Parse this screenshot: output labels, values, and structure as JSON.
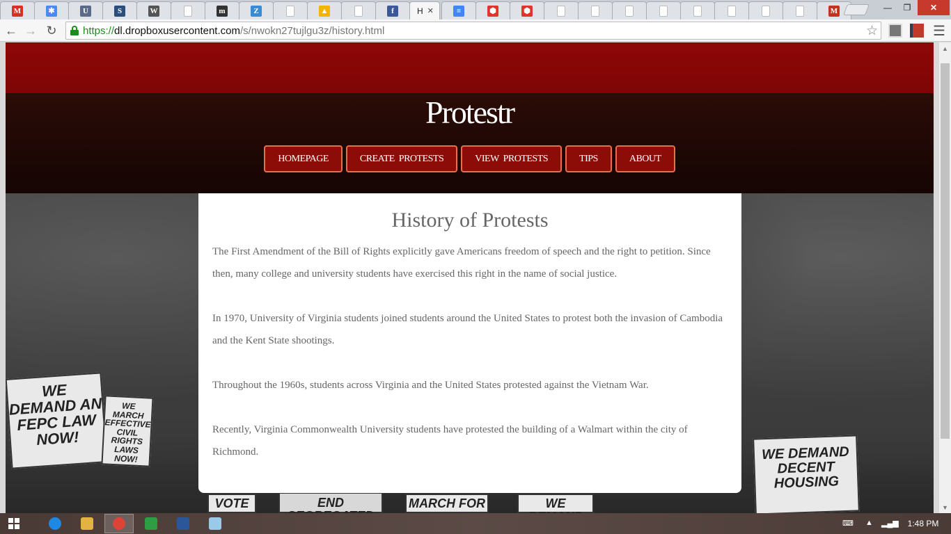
{
  "browser": {
    "active_tab": {
      "title": "H",
      "close": "✕"
    },
    "tabs": [
      {
        "icon": "gmail-icon",
        "glyph": "M",
        "color": "#d93025"
      },
      {
        "icon": "pinwheel-icon",
        "glyph": "✱",
        "color": "#4a8af4"
      },
      {
        "icon": "ucla-icon",
        "glyph": "U",
        "color": "#5c6b8a"
      },
      {
        "icon": "s-logo-icon",
        "glyph": "S",
        "color": "#2a4f7d"
      },
      {
        "icon": "wikipedia-icon",
        "glyph": "W",
        "color": "#555555"
      },
      {
        "icon": "page-icon",
        "glyph": "",
        "color": "#bbbbbb"
      },
      {
        "icon": "m-logo-icon",
        "glyph": "m",
        "color": "#333333"
      },
      {
        "icon": "z-logo-icon",
        "glyph": "Z",
        "color": "#3a8bd6"
      },
      {
        "icon": "page-icon",
        "glyph": "",
        "color": "#bbbbbb"
      },
      {
        "icon": "drive-icon",
        "glyph": "▲",
        "color": "#f4b400"
      },
      {
        "icon": "page-icon",
        "glyph": "",
        "color": "#bbbbbb"
      },
      {
        "icon": "facebook-icon",
        "glyph": "f",
        "color": "#3b5998"
      }
    ],
    "tabs_right": [
      {
        "icon": "docs-icon",
        "glyph": "≡",
        "color": "#4285f4"
      },
      {
        "icon": "hexagon-icon",
        "glyph": "⬢",
        "color": "#e0352b"
      },
      {
        "icon": "hexagon-icon",
        "glyph": "⬢",
        "color": "#e0352b"
      },
      {
        "icon": "page-icon",
        "glyph": "",
        "color": "#bbbbbb"
      },
      {
        "icon": "page-icon",
        "glyph": "",
        "color": "#bbbbbb"
      },
      {
        "icon": "page-icon",
        "glyph": "",
        "color": "#bbbbbb"
      },
      {
        "icon": "page-icon",
        "glyph": "",
        "color": "#bbbbbb"
      },
      {
        "icon": "page-icon",
        "glyph": "",
        "color": "#bbbbbb"
      },
      {
        "icon": "page-icon",
        "glyph": "",
        "color": "#bbbbbb"
      },
      {
        "icon": "page-icon",
        "glyph": "",
        "color": "#bbbbbb"
      },
      {
        "icon": "page-icon",
        "glyph": "",
        "color": "#bbbbbb"
      },
      {
        "icon": "gmail-m-icon",
        "glyph": "M",
        "color": "#c23321"
      }
    ],
    "url": {
      "scheme": "https://",
      "host": "dl.dropboxusercontent.com",
      "path": "/s/nwokn27tujlgu3z/history.html"
    }
  },
  "site": {
    "title": "Protestr",
    "nav": [
      "HOMEPAGE",
      "CREATE  PROTESTS",
      "VIEW  PROTESTS",
      "TIPS",
      "ABOUT"
    ]
  },
  "content": {
    "heading": "History of Protests",
    "paragraphs": [
      "The First Amendment of the Bill of Rights explicitly gave Americans freedom of speech and the right to petition. Since then, many college and university students have exercised this right in the name of social justice.",
      "In 1970, University of Virginia students joined students around the United States to protest both the invasion of Cambodia and the Kent State shootings.",
      "Throughout the 1960s, students across Virginia and the United States protested against the Vietnam War.",
      "Recently, Virginia Commonwealth University students have protested the building of a Walmart within the city of Richmond."
    ]
  },
  "photo_signs": [
    "WE DEMAND AN FEPC LAW NOW!",
    "WE MARCH EFFECTIVE CIVIL RIGHTS LAWS NOW!",
    "WE DEMAND DECENT HOUSING",
    "END SEGREGATED",
    "MARCH FOR",
    "WE DEMAND",
    "VOTE"
  ],
  "taskbar": {
    "clock": "1:48 PM",
    "apps": [
      {
        "icon": "ie-icon",
        "color": "#1e88e5"
      },
      {
        "icon": "folder-icon",
        "color": "#e3b341"
      },
      {
        "icon": "chrome-icon",
        "color": "#db4437"
      },
      {
        "icon": "store-icon",
        "color": "#2e9e44"
      },
      {
        "icon": "word-icon",
        "color": "#2b579a"
      },
      {
        "icon": "notepad-icon",
        "color": "#9bc9e8"
      }
    ]
  }
}
